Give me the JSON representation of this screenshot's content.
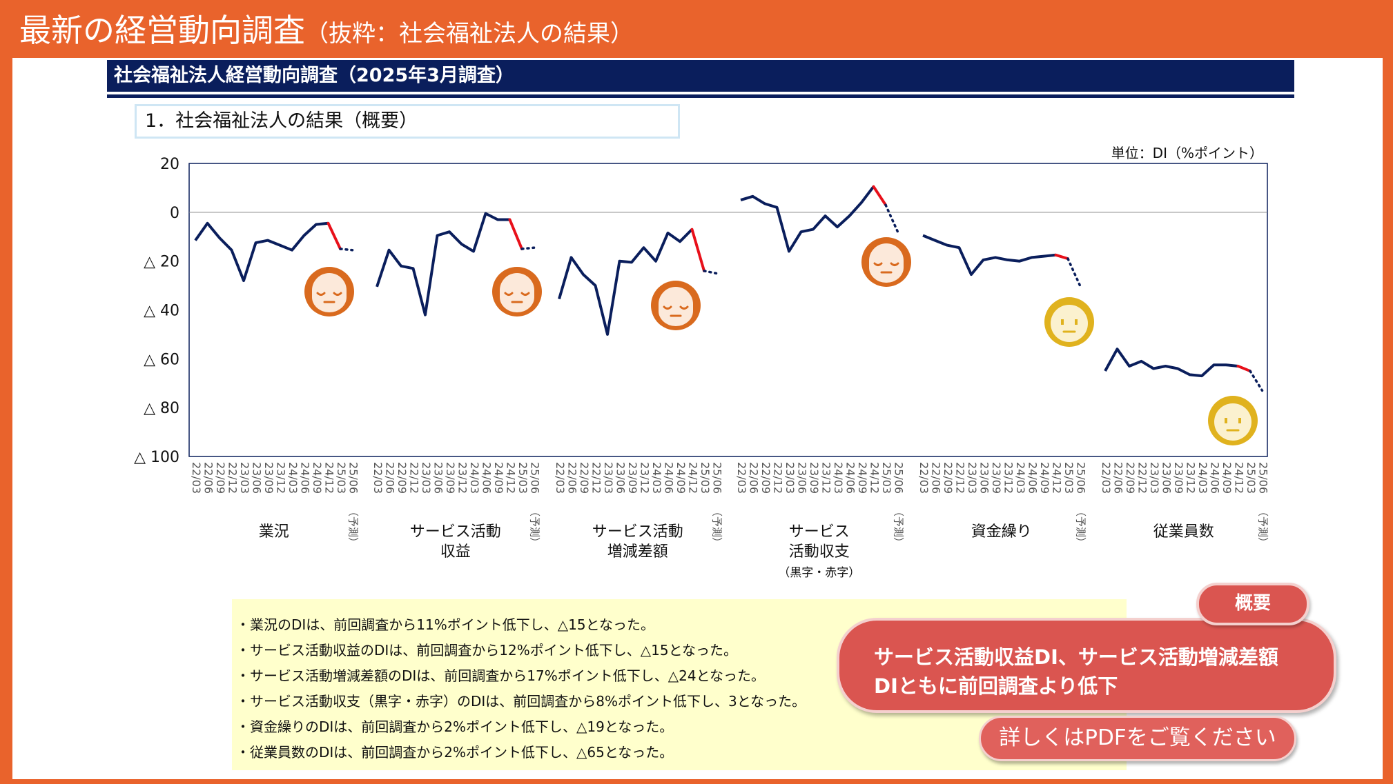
{
  "header": {
    "title_main": "最新の経営動向調査",
    "title_sub": "（抜粋：社会福祉法人の結果）"
  },
  "banner": "社会福祉法人経営動向調査（2025年3月調査）",
  "section_title": "1．社会福祉法人の結果（概要）",
  "unit_label": "単位：DI（%ポイント）",
  "colors": {
    "line": "#0A1E5C",
    "recent": "#E8101A",
    "face_orange": "#D96A1E",
    "face_yellow": "#E0B21E",
    "accent": "#E9632C"
  },
  "chart_data": {
    "type": "line",
    "ylim": [
      -100,
      20
    ],
    "yticks": [
      {
        "value": 20,
        "label": "20"
      },
      {
        "value": 0,
        "label": "0"
      },
      {
        "value": -20,
        "label": "△ 20"
      },
      {
        "value": -40,
        "label": "△ 40"
      },
      {
        "value": -60,
        "label": "△ 60"
      },
      {
        "value": -80,
        "label": "△ 80"
      },
      {
        "value": -100,
        "label": "△ 100"
      }
    ],
    "x_labels": [
      "22/03",
      "22/06",
      "22/09",
      "22/12",
      "23/03",
      "23/06",
      "23/09",
      "23/12",
      "24/03",
      "24/06",
      "24/09",
      "24/12",
      "25/03",
      "25/06"
    ],
    "forecast_label": "（予測）",
    "groups": [
      {
        "name_lines": [
          "業況"
        ],
        "values": [
          -11.5,
          -4.5,
          -10.5,
          -15.5,
          -28,
          -12.5,
          -11.5,
          -13.5,
          -15.5,
          -9.5,
          -5,
          -4.5
        ],
        "latest": -15,
        "forecast": -15.5,
        "face": "orange"
      },
      {
        "name_lines": [
          "サービス活動",
          "収益"
        ],
        "values": [
          -30.5,
          -15.5,
          -22,
          -23,
          -42,
          -9.5,
          -8,
          -13,
          -16,
          -0.5,
          -3,
          -3
        ],
        "latest": -15,
        "forecast": -14.5,
        "face": "orange"
      },
      {
        "name_lines": [
          "サービス活動",
          "増減差額"
        ],
        "values": [
          -35.5,
          -18.5,
          -25.5,
          -30,
          -50,
          -20,
          -20.5,
          -14.5,
          -20,
          -8.5,
          -12,
          -7
        ],
        "latest": -24,
        "forecast": -25,
        "face": "orange"
      },
      {
        "name_lines": [
          "サービス",
          "活動収支",
          "（黒字・赤字）"
        ],
        "values": [
          5,
          6.5,
          3.5,
          2,
          -16,
          -8,
          -7,
          -1.5,
          -6,
          -1.5,
          4,
          10.5
        ],
        "latest": 3,
        "forecast": -8,
        "face": "orange"
      },
      {
        "name_lines": [
          "資金繰り"
        ],
        "values": [
          -9.5,
          -11.5,
          -13.5,
          -14.5,
          -25.5,
          -19.5,
          -18.5,
          -19.5,
          -20,
          -18.5,
          -18,
          -17.5
        ],
        "latest": -19,
        "forecast": -30,
        "face": "yellow"
      },
      {
        "name_lines": [
          "従業員数"
        ],
        "values": [
          -65,
          -56,
          -63,
          -61,
          -64,
          -63,
          -64,
          -66.5,
          -67,
          -62.5,
          -62.5,
          -63
        ],
        "latest": -65,
        "forecast": -73,
        "face": "yellow"
      }
    ]
  },
  "notes": [
    "・業況のDIは、前回調査から11%ポイント低下し、△15となった。",
    "・サービス活動収益のDIは、前回調査から12%ポイント低下し、△15となった。",
    "・サービス活動増減差額のDIは、前回調査から17%ポイント低下し、△24となった。",
    "・サービス活動収支（黒字・赤字）のDIは、前回調査から8%ポイント低下し、3となった。",
    "・資金繰りのDIは、前回調査から2%ポイント低下し、△19となった。",
    "・従業員数のDIは、前回調査から2%ポイント低下し、△65となった。"
  ],
  "summary": {
    "tab_label": "概要",
    "line1": "サービス活動収益DI、サービス活動増減差額",
    "line2": "DIともに前回調査より低下"
  },
  "pdf_button": "詳しくはPDFをご覧ください"
}
